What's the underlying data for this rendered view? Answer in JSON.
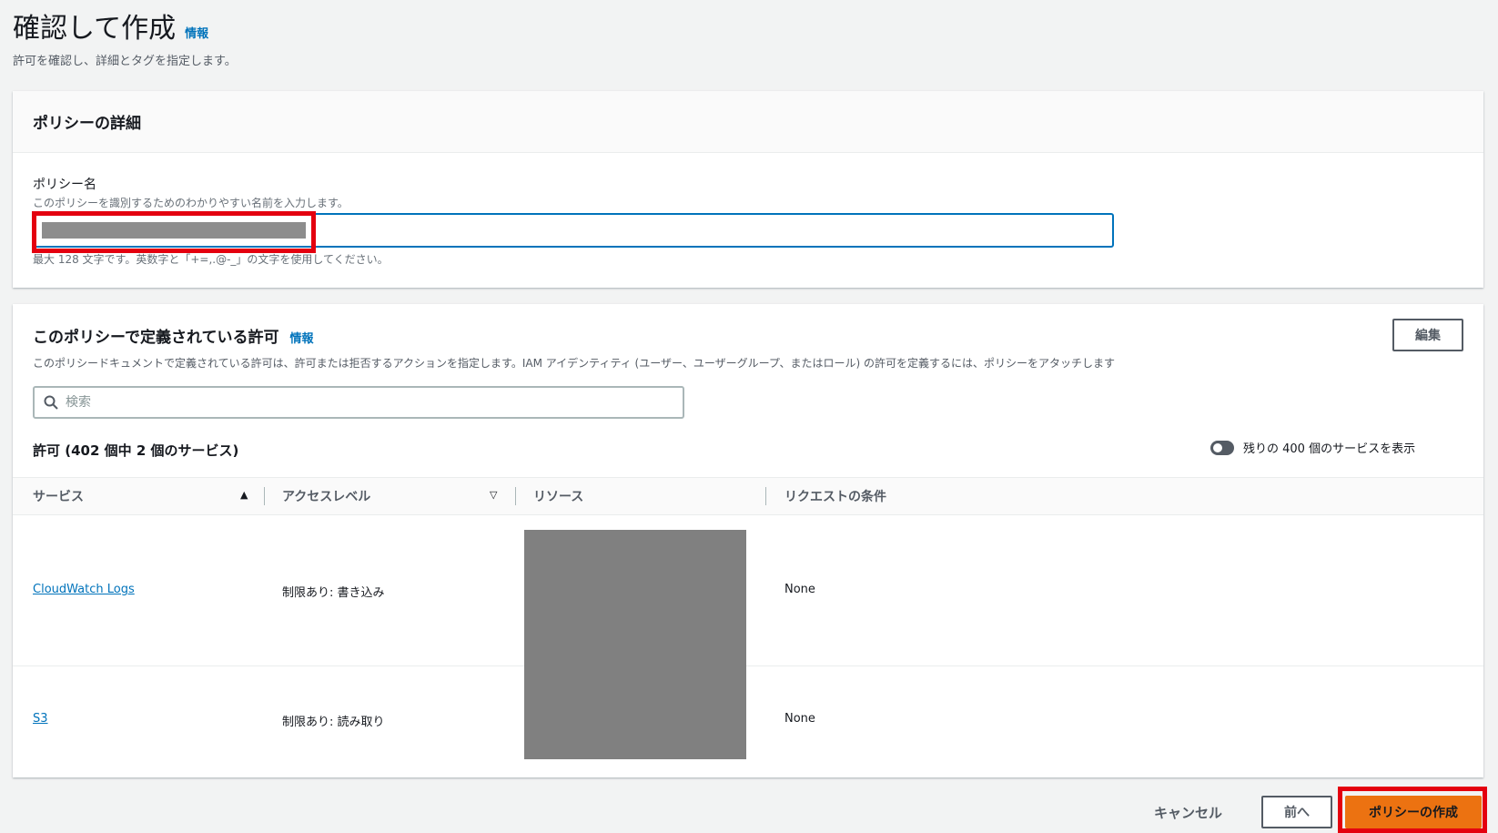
{
  "page": {
    "title": "確認して作成",
    "info_label": "情報",
    "subtitle": "許可を確認し、詳細とタグを指定します。"
  },
  "policy_details": {
    "heading": "ポリシーの詳細",
    "name_label": "ポリシー名",
    "name_description": "このポリシーを識別するためのわかりやすい名前を入力します。",
    "name_value": "",
    "name_constraint": "最大 128 文字です。英数字と「+=,.@-_」の文字を使用してください。"
  },
  "permissions": {
    "heading": "このポリシーで定義されている許可",
    "info_label": "情報",
    "edit_label": "編集",
    "description": "このポリシードキュメントで定義されている許可は、許可または拒否するアクションを指定します。IAM アイデンティティ (ユーザー、ユーザーグループ、またはロール) の許可を定義するには、ポリシーをアタッチします",
    "search_placeholder": "検索",
    "count_heading": "許可 (402 個中 2 個のサービス)",
    "toggle_label": "残りの 400 個のサービスを表示",
    "columns": [
      "サービス",
      "アクセスレベル",
      "リソース",
      "リクエストの条件"
    ],
    "rows": [
      {
        "service": "CloudWatch Logs",
        "access_level": "制限あり: 書き込み",
        "condition": "None"
      },
      {
        "service": "S3",
        "access_level": "制限あり: 読み取り",
        "condition": "None"
      }
    ]
  },
  "footer": {
    "cancel_label": "キャンセル",
    "prev_label": "前へ",
    "create_label": "ポリシーの作成"
  },
  "colors": {
    "primary_button": "#ec7211",
    "link": "#0073bb",
    "highlight": "#e4000f"
  }
}
